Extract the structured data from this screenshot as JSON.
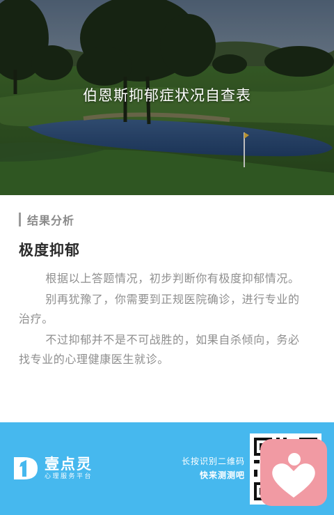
{
  "hero": {
    "title": "伯恩斯抑郁症状况自查表"
  },
  "result": {
    "section_label": "结果分析",
    "title": "极度抑郁",
    "paragraphs": [
      "根据以上答题情况，初步判断你有极度抑郁情况。",
      "别再犹豫了，你需要到正规医院确诊，进行专业的治疗。",
      "不过抑郁并不是不可战胜的，如果自杀倾向，务必找专业的心理健康医生就诊。"
    ]
  },
  "footer": {
    "logo_name": "壹点灵",
    "logo_sub": "心理服务平台",
    "logo_icon": "logo-mark-icon",
    "qr_hint_line1": "长按识别二维码",
    "qr_hint_line2": "快来测测吧",
    "qr_icon": "qr-code-icon",
    "badge_icon": "heart-person-icon"
  },
  "colors": {
    "footer_bg": "#46b8ee",
    "badge_bg": "#f19aa3",
    "body_text": "#8e8e8e",
    "title_text": "#2b2b2b"
  }
}
